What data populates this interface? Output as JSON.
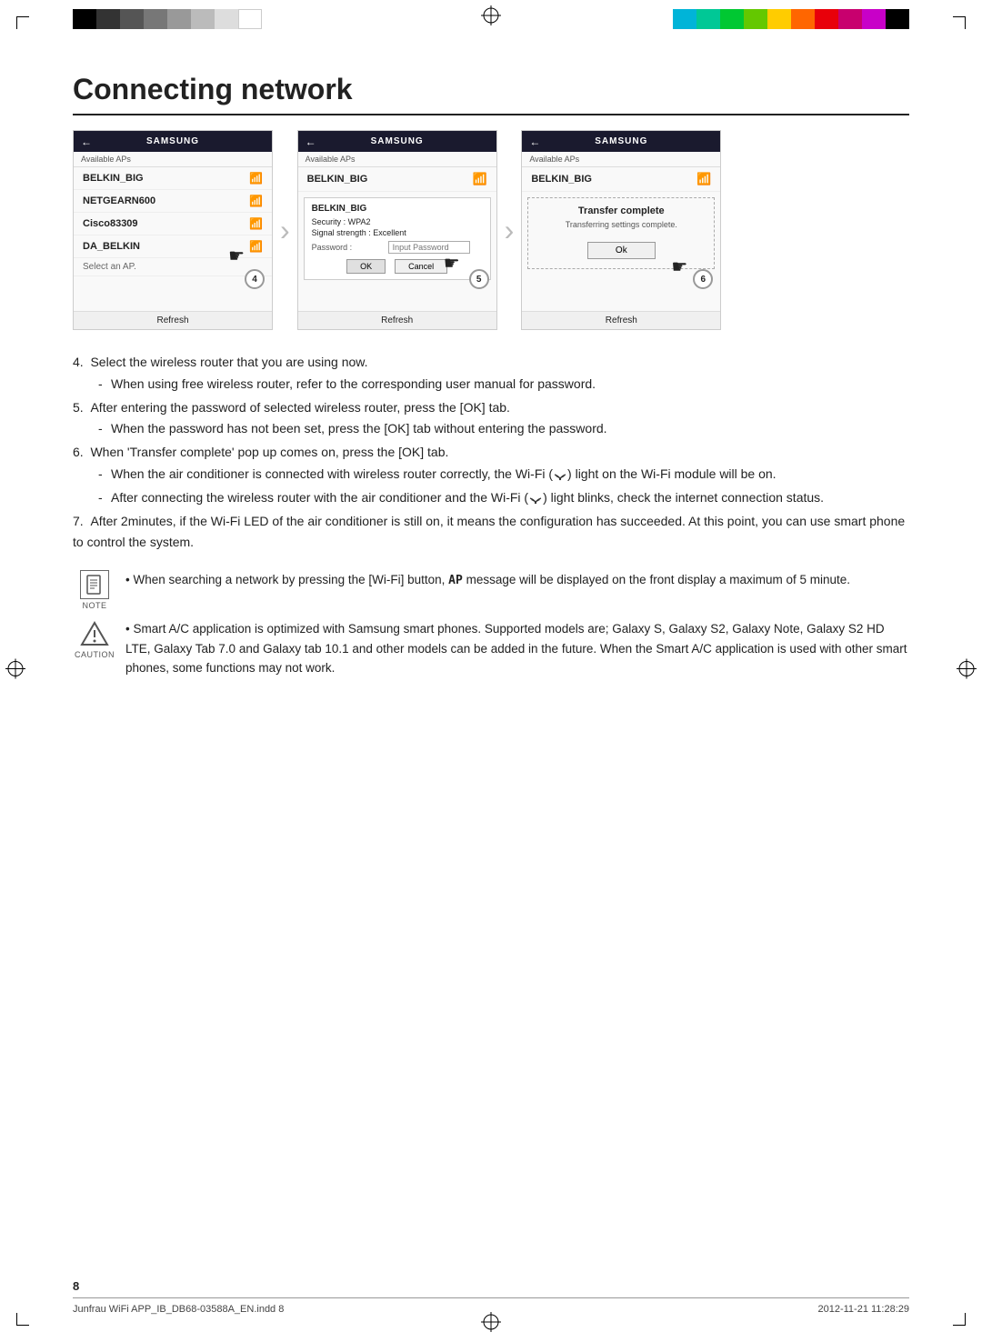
{
  "page": {
    "title": "Connecting network",
    "number": "8",
    "footer_left": "Junfrau WiFi APP_IB_DB68-03588A_EN.indd   8",
    "footer_right": "2012-11-21   11:28:29"
  },
  "screenshots": {
    "screen1": {
      "brand": "SAMSUNG",
      "subtitle": "Available APs",
      "networks": [
        {
          "name": "BELKIN_BIG",
          "wifi": true
        },
        {
          "name": "NETGEARN600",
          "wifi": true,
          "step": "4"
        },
        {
          "name": "Cisco83309",
          "wifi": true
        },
        {
          "name": "DA_BELKIN",
          "wifi": true
        }
      ],
      "select_ap_label": "Select an AP.",
      "refresh_label": "Refresh"
    },
    "screen2": {
      "brand": "SAMSUNG",
      "subtitle": "Available APs",
      "top_network": "BELKIN_BIG",
      "dialog": {
        "title": "BELKIN_BIG",
        "security_label": "Security : WPA2",
        "signal_label": "Signal strength : Excellent",
        "password_label": "Password :",
        "password_placeholder": "Input Password",
        "ok_label": "OK",
        "cancel_label": "Cancel"
      },
      "step": "5",
      "refresh_label": "Refresh"
    },
    "screen3": {
      "brand": "SAMSUNG",
      "subtitle": "Available APs",
      "top_network": "BELKIN_BIG",
      "transfer_complete": "Transfer complete",
      "transfer_sub": "Transferring settings complete.",
      "ok_label": "Ok",
      "step": "6",
      "refresh_label": "Refresh"
    }
  },
  "instructions": {
    "step4": {
      "num": "4.",
      "text": "Select the wireless router that you are using now.",
      "sub": "When using free wireless router, refer to the corresponding user manual for password."
    },
    "step5": {
      "num": "5.",
      "text": "After entering the password of selected wireless router, press the [OK] tab.",
      "sub": "When the password has not been set, press the [OK] tab without entering the password."
    },
    "step6": {
      "num": "6.",
      "text": "When 'Transfer complete' pop up comes on, press the [OK] tab.",
      "sub1": "When the air conditioner is connected with wireless router correctly, the Wi-Fi (",
      "wifi_symbol": "((•))",
      "sub1_end": ") light on the Wi-Fi module will be on.",
      "sub2": "After connecting the wireless router with the air conditioner and the Wi-Fi (",
      "sub2_end": ") light blinks, check the internet connection status."
    },
    "step7": {
      "num": "7.",
      "text": "After 2minutes, if the Wi-Fi LED of the air conditioner is still on, it means the configuration has succeeded. At this point, you can use smart phone to control the system."
    }
  },
  "note": {
    "icon_label": "NOTE",
    "text": "When searching a network by pressing the [Wi-Fi] button,",
    "ap_symbol": "AP",
    "text2": "message will be displayed on the front display a maximum of 5 minute."
  },
  "caution": {
    "icon_label": "CAUTION",
    "text": "Smart A/C application is optimized with Samsung smart phones. Supported models are; Galaxy S, Galaxy S2, Galaxy Note, Galaxy S2 HD LTE, Galaxy Tab 7.0 and Galaxy tab 10.1 and other models can be added in the future. When the Smart A/C application is used with other smart phones, some functions may not work."
  },
  "colors": {
    "header_bg": "#1a1a2e",
    "border": "#cccccc",
    "text_dark": "#222222",
    "text_mid": "#555555",
    "arrow": "#bbbbbb"
  }
}
